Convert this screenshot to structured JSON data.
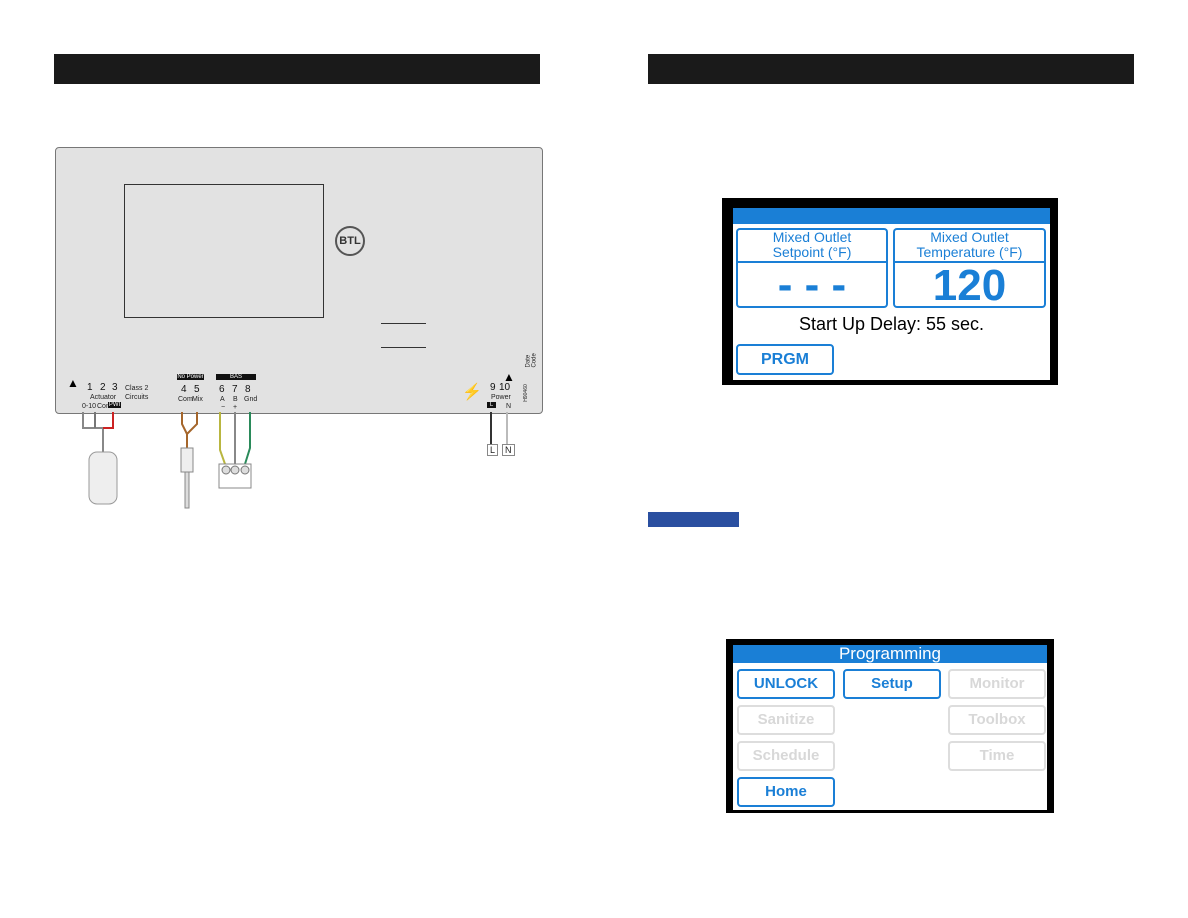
{
  "colors": {
    "accent_blue": "#1a7fd6",
    "header_black": "#1a1a1a",
    "badge_blue": "#2a4fa0",
    "panel_grey": "#e2e2e2"
  },
  "wiring": {
    "logo": "BTL",
    "terminals": {
      "t1": "1",
      "t2": "2",
      "t3": "3",
      "actuator": "Actuator",
      "t1_label": "0-10",
      "t2_label": "Com",
      "t3_label": "PWI",
      "class2": "Class 2",
      "circuits": "Circuits",
      "no_power": "No Power",
      "t4": "4",
      "t5": "5",
      "t4_label": "Com",
      "t5_label": "Mix",
      "bas": "BAS",
      "t6": "6",
      "t7": "7",
      "t8": "8",
      "t6_label": "A",
      "t7_label": "B",
      "t8_label": "Gnd",
      "t6_sign": "−",
      "t7_sign": "+",
      "t9": "9",
      "t10": "10",
      "power": "Power",
      "t9_label": "L",
      "t10_label": "N",
      "date_code": "Date Code",
      "model": "H90460"
    },
    "supply": {
      "l": "L",
      "n": "N"
    },
    "icons": {
      "warning": "warning-triangle-icon",
      "shock": "electric-shock-icon"
    }
  },
  "home_screen": {
    "setpoint_label_1": "Mixed Outlet",
    "setpoint_label_2": "Setpoint (°F)",
    "setpoint_value": "- - -",
    "temp_label_1": "Mixed Outlet",
    "temp_label_2": "Temperature (°F)",
    "temp_value": "120",
    "status": "Start Up Delay:  55 sec.",
    "prgm_button": "PRGM"
  },
  "programming_screen": {
    "title": "Programming",
    "buttons": [
      {
        "label": "UNLOCK",
        "enabled": true
      },
      {
        "label": "Setup",
        "enabled": true
      },
      {
        "label": "Monitor",
        "enabled": false
      },
      {
        "label": "Sanitize",
        "enabled": false
      },
      {
        "label": "Toolbox",
        "enabled": false
      },
      {
        "label": "Schedule",
        "enabled": false
      },
      {
        "label": "Time",
        "enabled": false
      },
      {
        "label": "Home",
        "enabled": true
      }
    ]
  }
}
